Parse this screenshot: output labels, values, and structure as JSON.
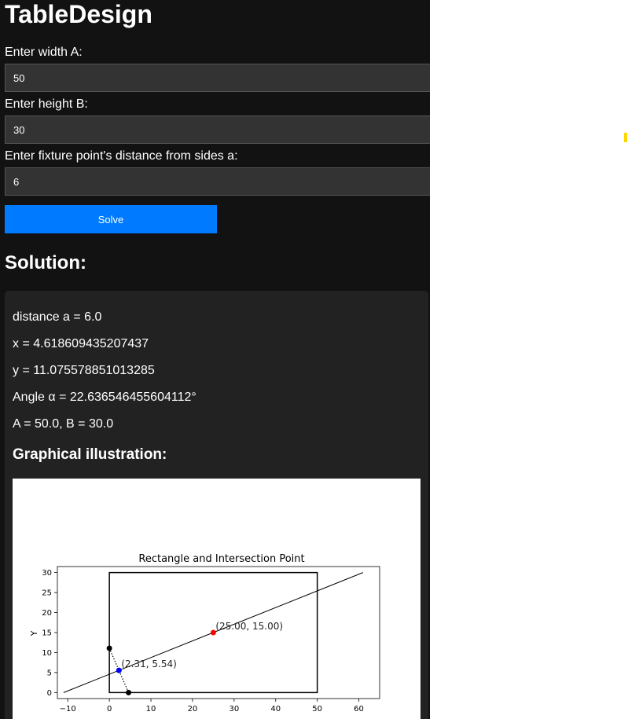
{
  "app": {
    "title": "TableDesign",
    "inputs": [
      {
        "label": "Enter width A:",
        "value": "50"
      },
      {
        "label": "Enter height B:",
        "value": "30"
      },
      {
        "label": "Enter fixture point's distance from sides a:",
        "value": "6"
      }
    ],
    "solve_label": "Solve",
    "solution_heading": "Solution:",
    "results": [
      "distance a = 6.0",
      "x = 4.618609435207437",
      "y = 11.075578851013285",
      "Angle α = 22.636546455604112°",
      "A = 50.0, B = 30.0"
    ],
    "illustration_heading": "Graphical illustration:"
  },
  "colors": {
    "background": "#121212",
    "panel": "#222222",
    "input_bg": "#333333",
    "button": "#007bff",
    "center_point": "#ff0000",
    "intersection_point": "#0000ff",
    "fixture_points": "#000000"
  },
  "chart_data": {
    "type": "line",
    "title": "Rectangle and Intersection Point",
    "xlabel": "",
    "ylabel": "Y",
    "xlim": [
      -12.5,
      65
    ],
    "ylim": [
      -1.5,
      31.5
    ],
    "xticks": [
      -10,
      0,
      10,
      20,
      30,
      40,
      50,
      60
    ],
    "yticks": [
      0,
      5,
      10,
      15,
      20,
      25,
      30
    ],
    "rectangle": {
      "x": [
        0,
        50
      ],
      "y": [
        0,
        30
      ]
    },
    "line": {
      "x": [
        -11,
        61
      ],
      "y": [
        0,
        30
      ]
    },
    "dotted_line": {
      "x": [
        0,
        4.62
      ],
      "y": [
        11.08,
        0
      ]
    },
    "points": [
      {
        "x": 25,
        "y": 15,
        "color": "#ff0000",
        "label": "(25.00, 15.00)"
      },
      {
        "x": 2.31,
        "y": 5.54,
        "color": "#0000ff",
        "label": "(2.31, 5.54)"
      },
      {
        "x": 0,
        "y": 11.08,
        "color": "#000000",
        "label": ""
      },
      {
        "x": 4.62,
        "y": 0,
        "color": "#000000",
        "label": ""
      }
    ]
  }
}
